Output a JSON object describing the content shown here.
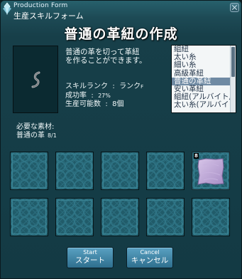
{
  "window": {
    "title_en": "Production Form",
    "title_jp": "生産スキルフォーム",
    "heading": "普通の革紐の作成"
  },
  "description": {
    "line1": "普通の革を切って革紐",
    "line2": "を作ることができます。"
  },
  "stats": {
    "rank_label": "スキルランク  :  ランク",
    "rank_value": "F",
    "success_label": "成功率  :  ",
    "success_value": "27%",
    "possible_label": "生産可能数  :  ",
    "possible_value": "8個"
  },
  "recipes": {
    "items": [
      "組紐",
      "太い糸",
      "細い糸",
      "高級革紐",
      "普通の革紐",
      "安い革紐",
      "組紐(アルバイト用)",
      "太い糸(アルバイト用)"
    ],
    "selected_index": 4
  },
  "materials": {
    "label": "必要な素材:",
    "name": "普通の革",
    "count": "8/1"
  },
  "slots": {
    "leather_count": "8"
  },
  "buttons": {
    "start_en": "Start",
    "start_jp": "スタート",
    "cancel_en": "Cancel",
    "cancel_jp": "キャンセル"
  },
  "colors": {
    "window_bg": "#173f49",
    "selected_row": "#6f8aa3",
    "button_bg": "#3f86a8",
    "leather": "#b9a0d2"
  }
}
